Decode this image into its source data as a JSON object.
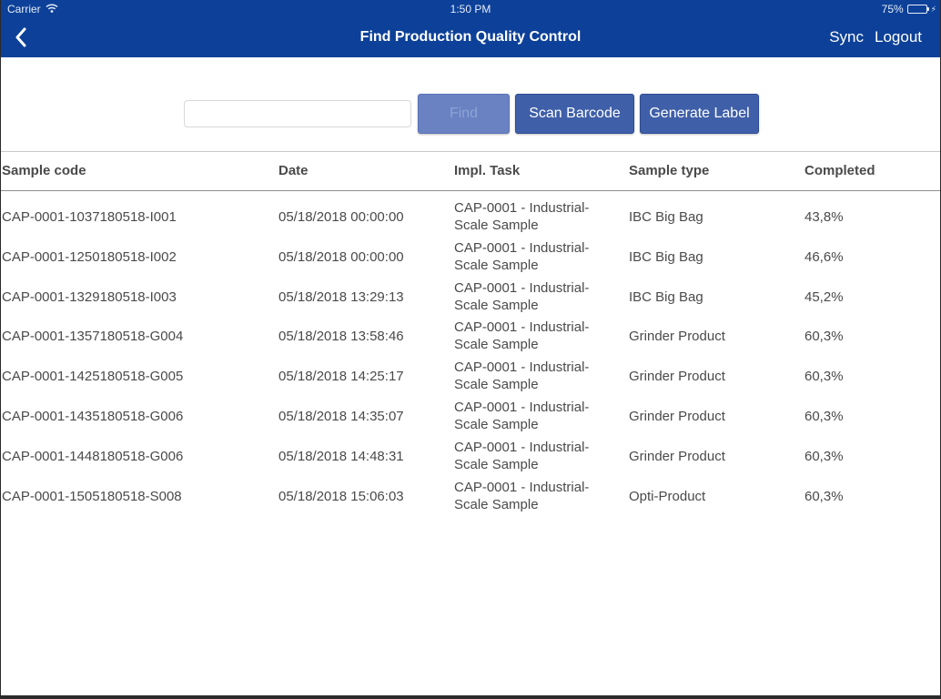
{
  "status_bar": {
    "carrier": "Carrier",
    "time": "1:50 PM",
    "battery": "75%",
    "battery_level": 0.75
  },
  "nav": {
    "title": "Find Production Quality Control",
    "back_icon": "chevron-left-icon",
    "sync_label": "Sync",
    "logout_label": "Logout"
  },
  "search": {
    "value": "",
    "placeholder": "",
    "find_label": "Find",
    "scan_label": "Scan Barcode",
    "generate_label": "Generate Label"
  },
  "table": {
    "headers": [
      "Sample code",
      "Date",
      "Impl. Task",
      "Sample type",
      "Completed"
    ],
    "rows": [
      [
        "CAP-0001-1037180518-I001",
        "05/18/2018 00:00:00",
        "CAP-0001 - Industrial-Scale Sample",
        "IBC Big Bag",
        "43,8%"
      ],
      [
        "CAP-0001-1250180518-I002",
        "05/18/2018 00:00:00",
        "CAP-0001 - Industrial-Scale Sample",
        "IBC Big Bag",
        "46,6%"
      ],
      [
        "CAP-0001-1329180518-I003",
        "05/18/2018 13:29:13",
        "CAP-0001 - Industrial-Scale Sample",
        "IBC Big Bag",
        "45,2%"
      ],
      [
        "CAP-0001-1357180518-G004",
        "05/18/2018 13:58:46",
        "CAP-0001 - Industrial-Scale Sample",
        "Grinder Product",
        "60,3%"
      ],
      [
        "CAP-0001-1425180518-G005",
        "05/18/2018 14:25:17",
        "CAP-0001 - Industrial-Scale Sample",
        "Grinder Product",
        "60,3%"
      ],
      [
        "CAP-0001-1435180518-G006",
        "05/18/2018 14:35:07",
        "CAP-0001 - Industrial-Scale Sample",
        "Grinder Product",
        "60,3%"
      ],
      [
        "CAP-0001-1448180518-G006",
        "05/18/2018 14:48:31",
        "CAP-0001 - Industrial-Scale Sample",
        "Grinder Product",
        "60,3%"
      ],
      [
        "CAP-0001-1505180518-S008",
        "05/18/2018 15:06:03",
        "CAP-0001 - Industrial-Scale Sample",
        "Opti-Product",
        "60,3%"
      ]
    ]
  },
  "colors": {
    "nav_background": "#0d4199",
    "button_background": "#3f5fa8",
    "button_disabled": "#6a82c2",
    "text": "#4a4a4a"
  }
}
